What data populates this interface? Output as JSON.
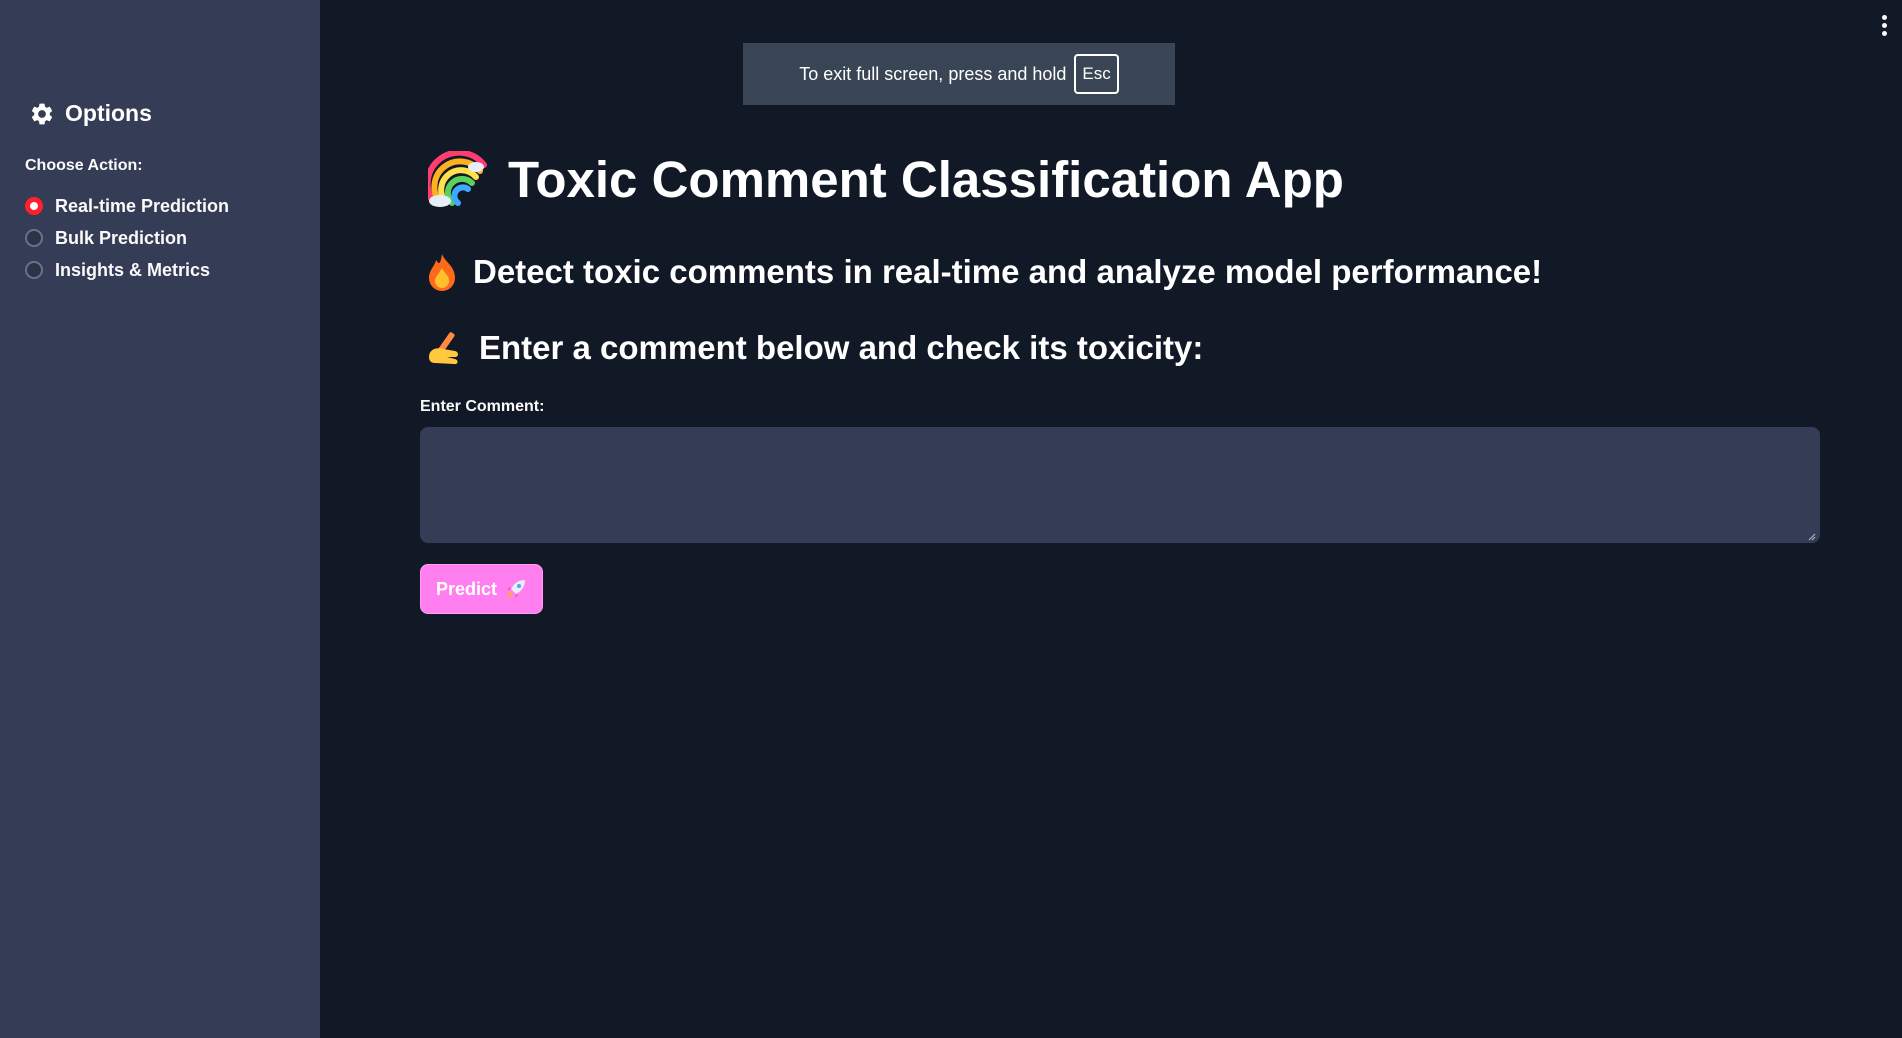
{
  "fullscreen_notice": {
    "text": "To exit full screen, press and hold",
    "key": "Esc"
  },
  "sidebar": {
    "title": "Options",
    "title_icon": "gear-icon",
    "radio_label": "Choose Action:",
    "options": [
      {
        "label": "Real-time Prediction",
        "selected": true
      },
      {
        "label": "Bulk Prediction",
        "selected": false
      },
      {
        "label": "Insights & Metrics",
        "selected": false
      }
    ]
  },
  "main": {
    "title": "Toxic Comment Classification App",
    "title_icon": "rainbow-icon",
    "subtitle": "Detect toxic comments in real-time and analyze model performance!",
    "subtitle_icon": "fire-icon",
    "prompt": "Enter a comment below and check its toxicity:",
    "prompt_icon": "writing-hand-icon",
    "comment_label": "Enter Comment:",
    "comment_value": "",
    "predict_label": "Predict",
    "predict_icon": "rocket-icon"
  },
  "colors": {
    "background": "#111927",
    "sidebar": "#353c55",
    "accent_radio": "#ff1f2d",
    "button": "#ff7ef0"
  }
}
